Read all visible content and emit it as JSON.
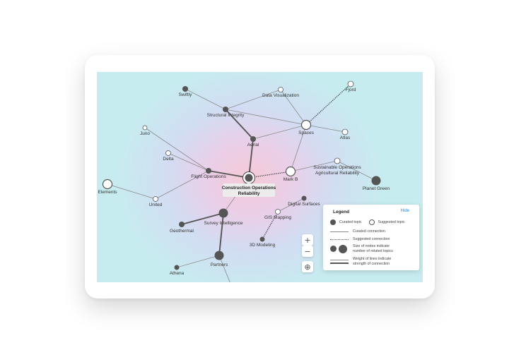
{
  "center": {
    "label_line1": "Construction Operations",
    "label_line2": "Reliability"
  },
  "nodes": [
    {
      "id": "swiftly",
      "label": "Swiftly",
      "kind": "curated"
    },
    {
      "id": "structural",
      "label": "Structural Integrity",
      "kind": "curated"
    },
    {
      "id": "dataviz",
      "label": "Data Visualization",
      "kind": "suggested"
    },
    {
      "id": "fjord",
      "label": "Fjord",
      "kind": "suggested"
    },
    {
      "id": "spaces",
      "label": "Spaces",
      "kind": "suggested"
    },
    {
      "id": "atlas",
      "label": "Atlas",
      "kind": "suggested"
    },
    {
      "id": "juno",
      "label": "Juno",
      "kind": "suggested"
    },
    {
      "id": "aerial",
      "label": "Aerial",
      "kind": "curated"
    },
    {
      "id": "delta",
      "label": "Delta",
      "kind": "suggested"
    },
    {
      "id": "flightops",
      "label": "Flight Operations",
      "kind": "curated"
    },
    {
      "id": "markb",
      "label": "Mark B",
      "kind": "suggested"
    },
    {
      "id": "sustainable",
      "label": "Sustainable Operations",
      "kind": "suggested"
    },
    {
      "id": "agricultural",
      "label": "Agricultural Reliability",
      "kind": "suggested"
    },
    {
      "id": "planetgreen",
      "label": "Planet Green",
      "kind": "curated"
    },
    {
      "id": "elements",
      "label": "Elements",
      "kind": "suggested"
    },
    {
      "id": "united",
      "label": "United",
      "kind": "suggested"
    },
    {
      "id": "digitalsurfaces",
      "label": "Digital Surfaces",
      "kind": "curated"
    },
    {
      "id": "gismapping",
      "label": "GIS Mapping",
      "kind": "suggested"
    },
    {
      "id": "surveyintel",
      "label": "Survey Intelligence",
      "kind": "curated"
    },
    {
      "id": "geothermal",
      "label": "Geothermal",
      "kind": "curated"
    },
    {
      "id": "modeling3d",
      "label": "3D Modeling",
      "kind": "curated"
    },
    {
      "id": "partners",
      "label": "Partners",
      "kind": "curated"
    },
    {
      "id": "athena",
      "label": "Athena",
      "kind": "curated"
    }
  ],
  "edges": [
    [
      "swiftly",
      "structural",
      "curated",
      1
    ],
    [
      "structural",
      "dataviz",
      "curated",
      1
    ],
    [
      "structural",
      "aerial",
      "curated",
      2
    ],
    [
      "structural",
      "spaces",
      "curated",
      1
    ],
    [
      "dataviz",
      "spaces",
      "curated",
      1
    ],
    [
      "fjord",
      "spaces",
      "suggested",
      1
    ],
    [
      "spaces",
      "atlas",
      "curated",
      1
    ],
    [
      "spaces",
      "aerial",
      "curated",
      1
    ],
    [
      "spaces",
      "markb",
      "curated",
      1
    ],
    [
      "aerial",
      "center",
      "curated",
      2
    ],
    [
      "juno",
      "flightops",
      "curated",
      1
    ],
    [
      "delta",
      "flightops",
      "curated",
      1
    ],
    [
      "flightops",
      "center",
      "curated",
      2
    ],
    [
      "flightops",
      "united",
      "curated",
      1
    ],
    [
      "center",
      "markb",
      "suggested",
      1
    ],
    [
      "markb",
      "sustainable",
      "curated",
      1
    ],
    [
      "sustainable",
      "planetgreen",
      "curated",
      1
    ],
    [
      "elements",
      "united",
      "curated",
      1
    ],
    [
      "center",
      "surveyintel",
      "curated",
      1
    ],
    [
      "surveyintel",
      "geothermal",
      "curated",
      2
    ],
    [
      "surveyintel",
      "partners",
      "curated",
      2
    ],
    [
      "partners",
      "athena",
      "curated",
      1
    ],
    [
      "partners",
      "offscreen",
      "curated",
      1
    ],
    [
      "digitalsurfaces",
      "gismapping",
      "curated",
      1
    ],
    [
      "gismapping",
      "modeling3d",
      "suggested",
      1
    ]
  ],
  "controls": {
    "zoom_in": "+",
    "zoom_out": "−",
    "recenter": "⊕",
    "zoom_in_icon": "plus-icon",
    "zoom_out_icon": "minus-icon",
    "recenter_icon": "crosshair-icon"
  },
  "legend": {
    "title": "Legend",
    "hide": "Hide",
    "curated_topic": "Curated topic",
    "suggested_topic": "Suggested topic",
    "curated_connection": "Curated connection",
    "suggested_connection": "Suggested connection",
    "size_line1": "Size of nodes indicate",
    "size_line2": "number of related topics",
    "weight_line1": "Weight of lines indicate",
    "weight_line2": "strength of connection"
  },
  "colors": {
    "curated_node": "#555555",
    "suggested_node": "#ffffff",
    "edge": "#8a8a8a",
    "strong_edge": "#555555",
    "link": "#1f8ad6"
  }
}
